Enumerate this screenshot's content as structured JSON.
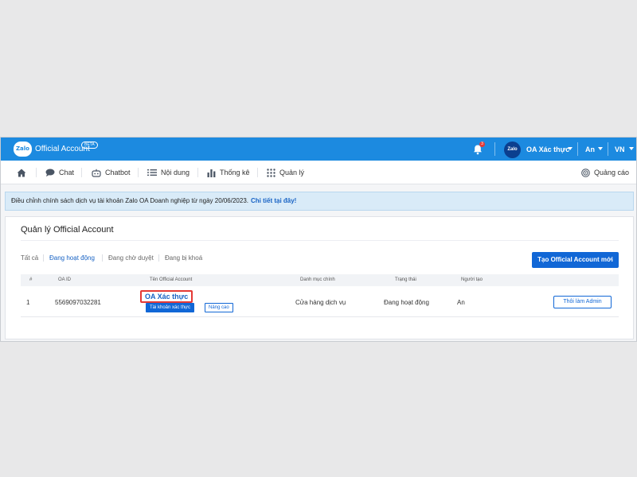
{
  "topbar": {
    "logo_text": "Zalo",
    "brand": "Official Account",
    "beta": "BETA",
    "notification_count": "3",
    "oa_avatar_text": "Zalo",
    "oa_name": "OA Xác thực",
    "user_name": "An",
    "language": "VN",
    "color": "#1c8ae0"
  },
  "nav": {
    "home_icon": "home-icon",
    "items": [
      {
        "label": "Chat",
        "icon": "chat-icon"
      },
      {
        "label": "Chatbot",
        "icon": "robot-icon"
      },
      {
        "label": "Nội dung",
        "icon": "list-icon"
      },
      {
        "label": "Thống kê",
        "icon": "bar-chart-icon"
      },
      {
        "label": "Quản lý",
        "icon": "grid-icon"
      }
    ],
    "ads": {
      "label": "Quảng cáo",
      "icon": "target-icon"
    }
  },
  "notice": {
    "text": "Điều chỉnh chính sách dịch vụ tài khoản Zalo OA Doanh nghiệp từ ngày 20/06/2023.",
    "link": "Chi tiết tại đây!"
  },
  "panel": {
    "title": "Quản lý Official Account",
    "filters": [
      "Tất cả",
      "Đang hoạt động",
      "Đang chờ duyệt",
      "Đang bị khoá"
    ],
    "active_filter": "Đang hoạt động",
    "create_button": "Tạo Official Account mới"
  },
  "table": {
    "columns": [
      "#",
      "OA ID",
      "Tên Official Account",
      "Danh mục chính",
      "Trạng thái",
      "Người tạo"
    ],
    "rows": [
      {
        "index": "1",
        "oa_id": "5569097032281",
        "name": "OA Xác thực",
        "badges": [
          "Tài khoản xác thực",
          "Nâng cao"
        ],
        "category": "Cửa hàng dịch vụ",
        "status": "Đang hoạt động",
        "creator": "An",
        "action": "Thôi làm Admin"
      }
    ]
  }
}
